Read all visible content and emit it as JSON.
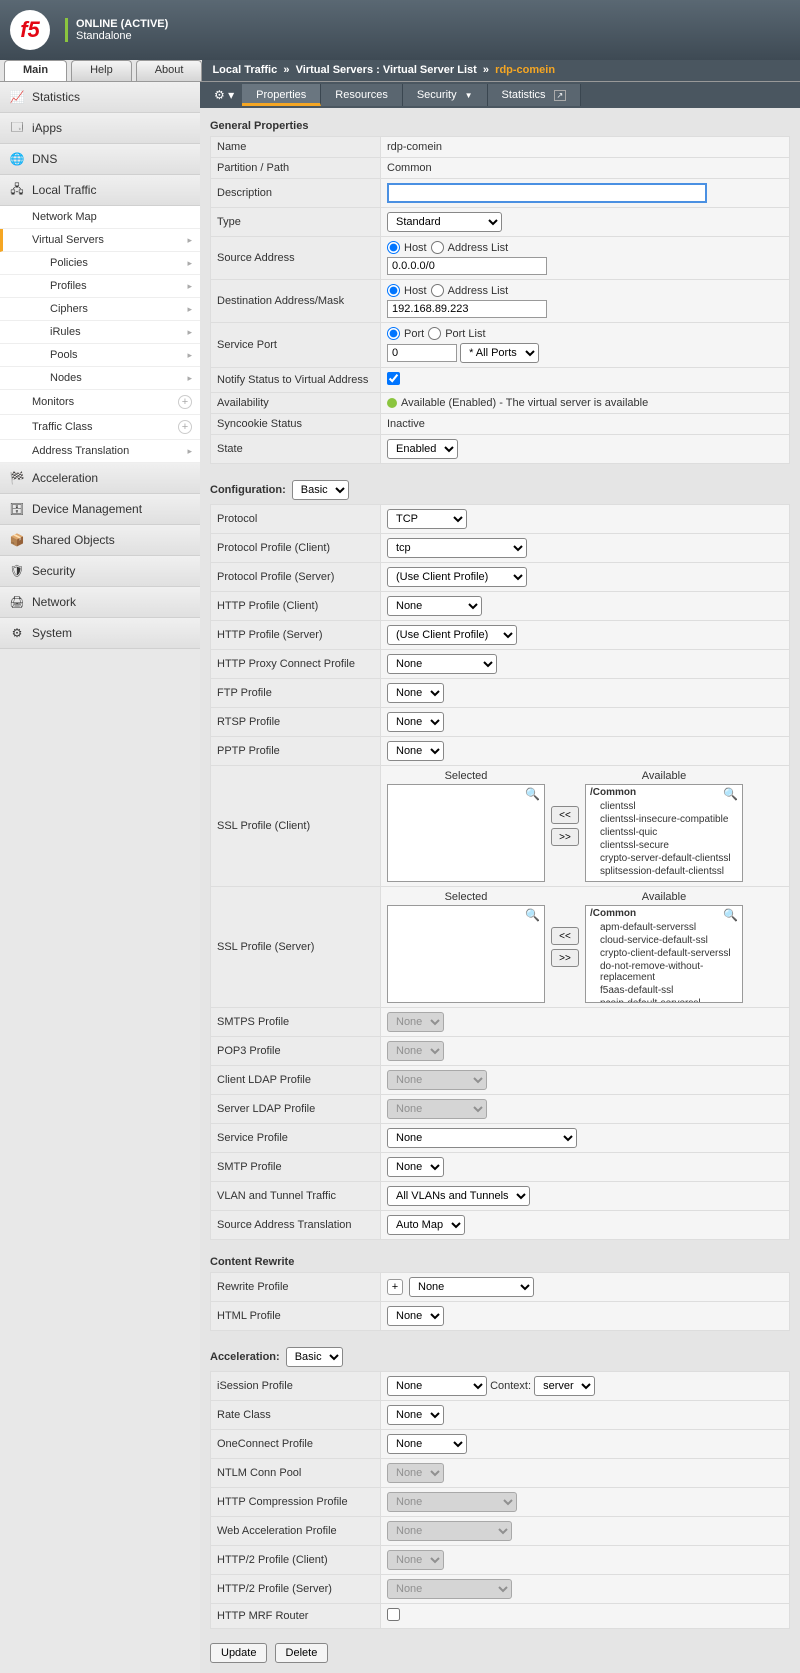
{
  "header": {
    "status1": "ONLINE (ACTIVE)",
    "status2": "Standalone",
    "logo": "f5"
  },
  "tabs": {
    "main": "Main",
    "help": "Help",
    "about": "About"
  },
  "breadcrumb": {
    "a": "Local Traffic",
    "b": "Virtual Servers : Virtual Server List",
    "cur": "rdp-comein",
    "sep": "»"
  },
  "subtabs": {
    "gear": "⚙ ▾",
    "properties": "Properties",
    "resources": "Resources",
    "security": "Security",
    "statistics": "Statistics"
  },
  "nav": {
    "statistics": "Statistics",
    "iapps": "iApps",
    "dns": "DNS",
    "localtraffic": "Local Traffic",
    "networkmap": "Network Map",
    "virtualservers": "Virtual Servers",
    "policies": "Policies",
    "profiles": "Profiles",
    "ciphers": "Ciphers",
    "irules": "iRules",
    "pools": "Pools",
    "nodes": "Nodes",
    "monitors": "Monitors",
    "trafficclass": "Traffic Class",
    "addresstrans": "Address Translation",
    "acceleration": "Acceleration",
    "devicemgmt": "Device Management",
    "sharedobj": "Shared Objects",
    "security": "Security",
    "network": "Network",
    "system": "System"
  },
  "sections": {
    "general": "General Properties",
    "config": "Configuration:",
    "config_sel": "Basic",
    "content": "Content Rewrite",
    "accel": "Acceleration:",
    "accel_sel": "Basic"
  },
  "labels": {
    "name": "Name",
    "partition": "Partition / Path",
    "description": "Description",
    "type": "Type",
    "srcaddr": "Source Address",
    "dstaddr": "Destination Address/Mask",
    "svcport": "Service Port",
    "notify": "Notify Status to Virtual Address",
    "avail": "Availability",
    "syncookie": "Syncookie Status",
    "state": "State",
    "protocol": "Protocol",
    "ppc": "Protocol Profile (Client)",
    "pps": "Protocol Profile (Server)",
    "httpc": "HTTP Profile (Client)",
    "https": "HTTP Profile (Server)",
    "httpproxy": "HTTP Proxy Connect Profile",
    "ftp": "FTP Profile",
    "rtsp": "RTSP Profile",
    "pptp": "PPTP Profile",
    "sslc": "SSL Profile (Client)",
    "ssls": "SSL Profile (Server)",
    "smtps": "SMTPS Profile",
    "pop3": "POP3 Profile",
    "cldap": "Client LDAP Profile",
    "sldap": "Server LDAP Profile",
    "svcprof": "Service Profile",
    "smtp": "SMTP Profile",
    "vlan": "VLAN and Tunnel Traffic",
    "snat": "Source Address Translation",
    "rewrite": "Rewrite Profile",
    "html": "HTML Profile",
    "isession": "iSession Profile",
    "context_lbl": "Context:",
    "rate": "Rate Class",
    "oneconnect": "OneConnect Profile",
    "ntlm": "NTLM Conn Pool",
    "httpcomp": "HTTP Compression Profile",
    "webaccel": "Web Acceleration Profile",
    "http2c": "HTTP/2 Profile (Client)",
    "http2s": "HTTP/2 Profile (Server)",
    "mrf": "HTTP MRF Router",
    "host": "Host",
    "addrlist": "Address List",
    "port": "Port",
    "portlist": "Port List",
    "selected": "Selected",
    "available": "Available"
  },
  "values": {
    "name": "rdp-comein",
    "partition": "Common",
    "type": "Standard",
    "srcaddr": "0.0.0.0/0",
    "dstaddr": "192.168.89.223",
    "svcport": "0",
    "svcport_sel": "* All Ports",
    "avail": "Available (Enabled) - The virtual server is available",
    "syncookie": "Inactive",
    "state": "Enabled",
    "protocol": "TCP",
    "ppc": "tcp",
    "pps": "(Use Client Profile)",
    "httpc": "None",
    "https": "(Use Client Profile)",
    "httpproxy": "None",
    "ftp": "None",
    "rtsp": "None",
    "pptp": "None",
    "smtps": "None",
    "pop3": "None",
    "cldap": "None",
    "sldap": "None",
    "svcprof": "None",
    "smtp": "None",
    "vlan": "All VLANs and Tunnels",
    "snat": "Auto Map",
    "rewrite": "None",
    "html": "None",
    "isession": "None",
    "context": "server",
    "rate": "None",
    "oneconnect": "None",
    "ntlm": "None",
    "httpcomp": "None",
    "webaccel": "None",
    "http2c": "None",
    "http2s": "None"
  },
  "sslc_avail": {
    "group": "/Common",
    "opts": [
      "clientssl",
      "clientssl-insecure-compatible",
      "clientssl-quic",
      "clientssl-secure",
      "crypto-server-default-clientssl",
      "splitsession-default-clientssl"
    ]
  },
  "ssls_avail": {
    "group": "/Common",
    "opts": [
      "apm-default-serverssl",
      "cloud-service-default-ssl",
      "crypto-client-default-serverssl",
      "do-not-remove-without-replacement",
      "f5aas-default-ssl",
      "pcoip-default-serverssl"
    ]
  },
  "buttons": {
    "update": "Update",
    "delete": "Delete",
    "ll": "<<",
    "rr": ">>",
    "plus": "+"
  }
}
